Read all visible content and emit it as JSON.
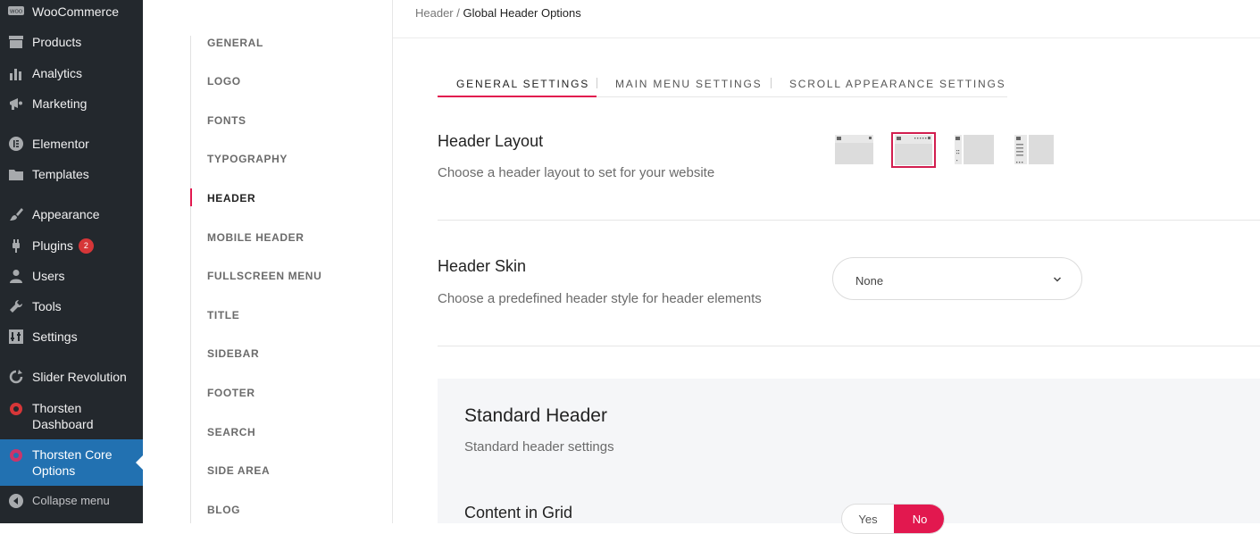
{
  "wp_menu": {
    "items": [
      {
        "label": "WooCommerce",
        "icon": "woo-icon"
      },
      {
        "label": "Products",
        "icon": "products-icon"
      },
      {
        "label": "Analytics",
        "icon": "analytics-icon"
      },
      {
        "label": "Marketing",
        "icon": "marketing-icon"
      },
      {
        "label": "Elementor",
        "icon": "elementor-icon"
      },
      {
        "label": "Templates",
        "icon": "folder-icon"
      },
      {
        "label": "Appearance",
        "icon": "brush-icon"
      },
      {
        "label": "Plugins",
        "icon": "plugin-icon",
        "badge": "2"
      },
      {
        "label": "Users",
        "icon": "user-icon"
      },
      {
        "label": "Tools",
        "icon": "wrench-icon"
      },
      {
        "label": "Settings",
        "icon": "settings-icon"
      },
      {
        "label": "Slider Revolution",
        "icon": "refresh-icon"
      },
      {
        "label": "Thorsten Dashboard",
        "icon": "thorsten-icon"
      },
      {
        "label": "Thorsten Core Options",
        "icon": "thorsten-icon"
      },
      {
        "label": "Collapse menu",
        "icon": "collapse-icon"
      }
    ]
  },
  "options_nav": {
    "items": [
      "GENERAL",
      "LOGO",
      "FONTS",
      "TYPOGRAPHY",
      "HEADER",
      "MOBILE HEADER",
      "FULLSCREEN MENU",
      "TITLE",
      "SIDEBAR",
      "FOOTER",
      "SEARCH",
      "SIDE AREA",
      "BLOG"
    ],
    "active": "HEADER"
  },
  "breadcrumb": {
    "parent": "Header",
    "separator": "/",
    "current": "Global Header Options"
  },
  "tabs": [
    "GENERAL SETTINGS",
    "MAIN MENU SETTINGS",
    "SCROLL APPEARANCE SETTINGS"
  ],
  "header_layout": {
    "title": "Header Layout",
    "description": "Choose a header layout to set for your website",
    "selected_index": 1
  },
  "header_skin": {
    "title": "Header Skin",
    "description": "Choose a predefined header style for header elements",
    "value": "None"
  },
  "standard_header": {
    "title": "Standard Header",
    "description": "Standard header settings",
    "content_in_grid": {
      "label": "Content in Grid",
      "yes": "Yes",
      "no": "No",
      "selected": "No"
    }
  },
  "colors": {
    "accent": "#e2184f",
    "wp_active": "#2271b1",
    "wp_bg": "#23282d",
    "plugin_badge": "#d63638"
  }
}
